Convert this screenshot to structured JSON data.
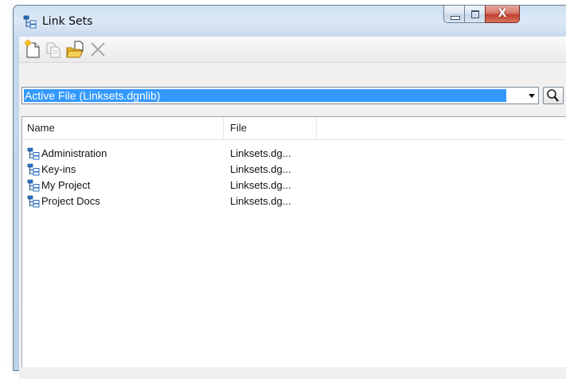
{
  "window": {
    "title": "Link Sets",
    "title_icon": "link-set-tree-icon",
    "close_glyph": "X"
  },
  "toolbar": {
    "buttons": [
      {
        "name": "new-link-set-button",
        "icon": "new-document-icon"
      },
      {
        "name": "copy-link-set-button",
        "icon": "copy-icon",
        "disabled": true
      },
      {
        "name": "open-link-set-button",
        "icon": "open-folder-icon"
      },
      {
        "name": "delete-link-set-button",
        "icon": "delete-x-icon",
        "disabled": true
      }
    ]
  },
  "file_selector": {
    "selected": "Active File (Linksets.dgnlib)",
    "dropdown_icon": "chevron-down-icon",
    "search_icon": "magnifier-icon"
  },
  "list": {
    "columns": [
      "Name",
      "File"
    ],
    "rows": [
      {
        "name": "Administration",
        "file": "Linksets.dg..."
      },
      {
        "name": "Key-ins",
        "file": "Linksets.dg..."
      },
      {
        "name": "My Project",
        "file": "Linksets.dg..."
      },
      {
        "name": "Project Docs",
        "file": "Linksets.dg..."
      }
    ],
    "row_icon": "link-set-tree-icon"
  },
  "colors": {
    "selection": "#3399ff",
    "icon_blue": "#2a6fbe",
    "close_red": "#c2412f"
  }
}
